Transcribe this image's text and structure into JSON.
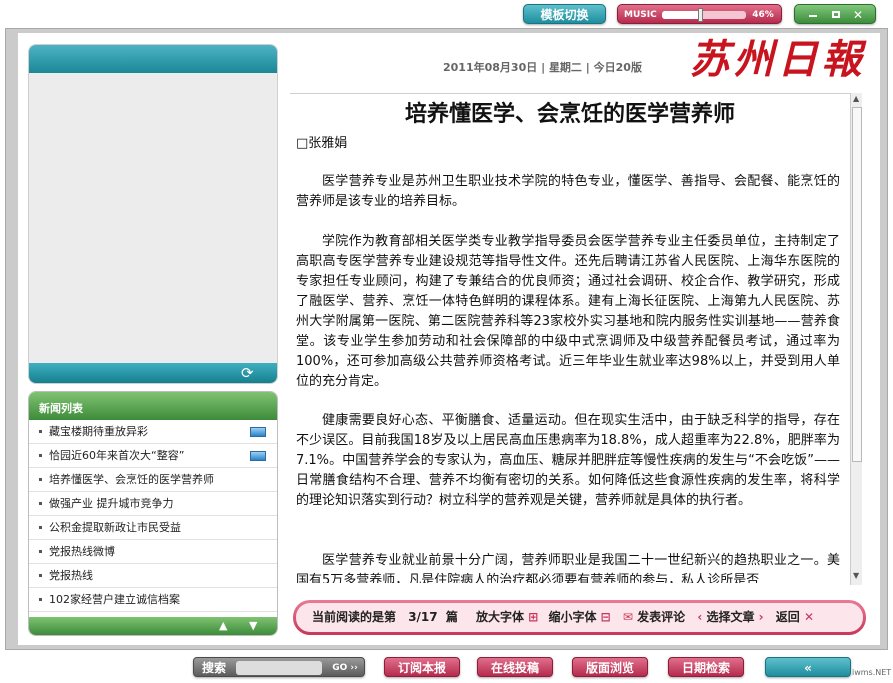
{
  "topbar": {
    "template_switch": "模板切换",
    "music_label": "MUSIC",
    "music_volume": "46%"
  },
  "header": {
    "date": "2011年08月30日",
    "weekday": "星期二",
    "pages_today": "今日20版",
    "masthead": "苏州日報"
  },
  "news_list": {
    "title": "新闻列表",
    "items": [
      "藏宝楼期待重放异彩",
      "恰园近60年来首次大“整容”",
      "培养懂医学、会烹饪的医学营养师",
      "做强产业  提升城市竞争力",
      "公积金提取新政让市民受益",
      "党报热线微博",
      "党报热线",
      "102家经营户建立诚信档案"
    ]
  },
  "article": {
    "title": "培养懂医学、会烹饪的医学营养师",
    "author": "□张雅娟",
    "paragraphs": [
      "医学营养专业是苏州卫生职业技术学院的特色专业，懂医学、善指导、会配餐、能烹饪的营养师是该专业的培养目标。",
      "学院作为教育部相关医学类专业教学指导委员会医学营养专业主任委员单位，主持制定了高职高专医学营养专业建设规范等指导性文件。还先后聘请江苏省人民医院、上海华东医院的专家担任专业顾问，构建了专兼结合的优良师资；通过社会调研、校企合作、教学研究，形成了融医学、营养、烹饪一体特色鲜明的课程体系。建有上海长征医院、上海第九人民医院、苏州大学附属第一医院、第二医院营养科等23家校外实习基地和院内服务性实训基地——营养食堂。该专业学生参加劳动和社会保障部的中级中式烹调师及中级营养配餐员考试，通过率为100%，还可参加高级公共营养师资格考试。近三年毕业生就业率达98%以上，并受到用人单位的充分肯定。",
      "健康需要良好心态、平衡膳食、适量运动。但在现实生活中，由于缺乏科学的指导，存在不少误区。目前我国18岁及以上居民高血压患病率为18.8%，成人超重率为22.8%，肥胖率为7.1%。中国营养学会的专家认为，高血压、糖尿并肥胖症等慢性疾病的发生与“不会吃饭”——日常膳食结构不合理、营养不均衡有密切的关系。如何降低这些食源性疾病的发生率，将科学的理论知识落实到行动？树立科学的营养观是关键，营养师就是具体的执行者。",
      "医学营养专业就业前景十分广阔，营养师职业是我国二十一世纪新兴的趋热职业之一。美国有5万多营养师，凡是住院病人的治疗都必须要有营养师的参与，私人诊所是否"
    ]
  },
  "status": {
    "reading_label": "当前阅读的是第",
    "reading_value": "3/17",
    "reading_unit": "篇",
    "enlarge": "放大字体",
    "shrink": "缩小字体",
    "comment": "发表评论",
    "select": "选择文章",
    "back": "返回"
  },
  "bottombar": {
    "search_label": "搜索",
    "go_label": "GO ››",
    "subscribe": "订阅本报",
    "submit": "在线投稿",
    "browse": "版面浏览",
    "date_search": "日期检索",
    "collapse": "«",
    "watermark": "iwms.NET"
  },
  "colors": {
    "teal": "#1e8e9e",
    "brand_red": "#c8141f",
    "pink": "#c8375a",
    "green": "#3d8b3a"
  }
}
